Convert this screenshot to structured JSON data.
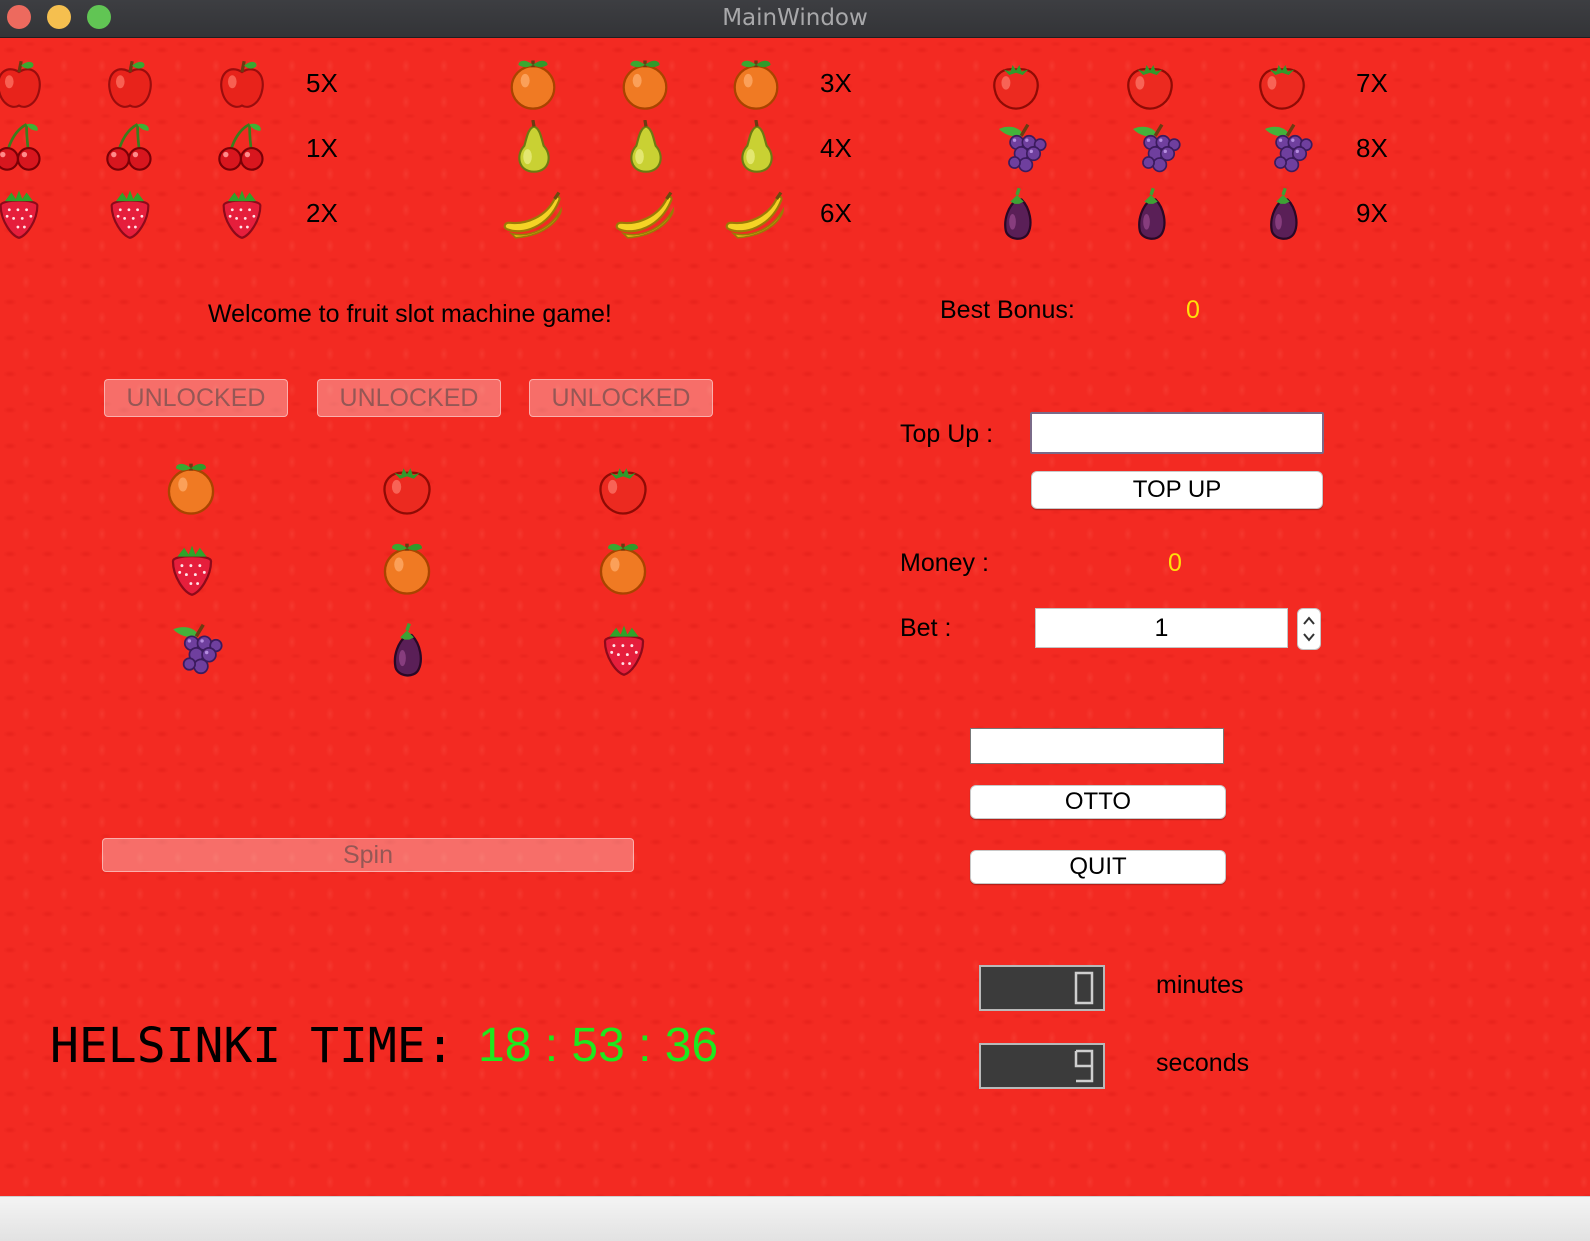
{
  "window": {
    "title": "MainWindow"
  },
  "paytable": {
    "rows": [
      {
        "fruit": "apple",
        "multiplier": "5X"
      },
      {
        "fruit": "cherry",
        "multiplier": "1X"
      },
      {
        "fruit": "strawberry",
        "multiplier": "2X"
      },
      {
        "fruit": "orange",
        "multiplier": "3X"
      },
      {
        "fruit": "pear",
        "multiplier": "4X"
      },
      {
        "fruit": "banana",
        "multiplier": "6X"
      },
      {
        "fruit": "tomato",
        "multiplier": "7X"
      },
      {
        "fruit": "grapes",
        "multiplier": "8X"
      },
      {
        "fruit": "eggplant",
        "multiplier": "9X"
      }
    ]
  },
  "welcome": "Welcome to fruit slot machine game!",
  "lock_buttons": [
    "UNLOCKED",
    "UNLOCKED",
    "UNLOCKED"
  ],
  "reels": [
    [
      "orange",
      "strawberry",
      "grapes"
    ],
    [
      "tomato",
      "orange",
      "eggplant"
    ],
    [
      "tomato",
      "orange",
      "strawberry"
    ]
  ],
  "spin_label": "Spin",
  "best_bonus": {
    "label": "Best Bonus:",
    "value": "0"
  },
  "top_up": {
    "label": "Top Up :",
    "value": "",
    "button": "TOP UP"
  },
  "money": {
    "label": "Money :",
    "value": "0"
  },
  "bet": {
    "label": "Bet :",
    "value": "1"
  },
  "otto": {
    "input_value": "",
    "button": "OTTO"
  },
  "quit_label": "QUIT",
  "timer": {
    "minutes_value": "0",
    "minutes_label": "minutes",
    "seconds_value": "9",
    "seconds_label": "seconds"
  },
  "clock": {
    "label": "HELSINKI TIME:",
    "time": "18 : 53 : 36"
  },
  "colors": {
    "background": "#f32a22",
    "value_yellow": "#ffe10a",
    "clock_green": "#1ee81e"
  }
}
